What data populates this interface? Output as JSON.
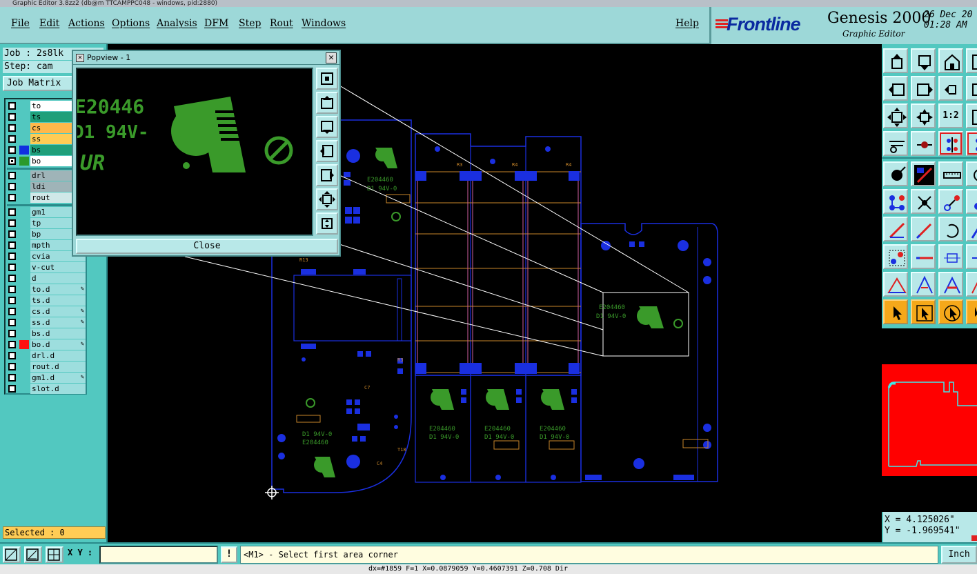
{
  "window": {
    "title_bar": "Graphic Editor 3.8zz2 (db@m TTCAMPPC048 - windows, pid:2880)"
  },
  "menu": {
    "items": [
      "File",
      "Edit",
      "Actions",
      "Options",
      "Analysis",
      "DFM",
      "Step",
      "Rout",
      "Windows"
    ],
    "help": "Help"
  },
  "brand": {
    "logo": "Frontline",
    "product": "Genesis 2000",
    "subtitle": "Graphic Editor",
    "date_line1": "26 Dec 20",
    "date_line2": "01:28 AM"
  },
  "job": {
    "job_label": "Job : 2s8lk",
    "step_label": "Step: cam",
    "matrix_button": "Job Matrix"
  },
  "layers": [
    {
      "name": "to",
      "bg": "#ffffff",
      "swatch": "",
      "lock": false
    },
    {
      "name": "ts",
      "bg": "#1f9f7a",
      "swatch": "",
      "lock": false
    },
    {
      "name": "cs",
      "bg": "#ffb84a",
      "swatch": "",
      "lock": false
    },
    {
      "name": "ss",
      "bg": "#ffcc55",
      "swatch": "",
      "lock": false
    },
    {
      "name": "bs",
      "bg": "#1f9f7a",
      "swatch": "#1030e0",
      "lock": false
    },
    {
      "name": "bo",
      "bg": "#ffffff",
      "swatch": "#2a9a2a",
      "lock": false,
      "active": true
    },
    {
      "name": "drl",
      "bg": "#9fb4b8",
      "swatch": "",
      "lock": false
    },
    {
      "name": "ldi",
      "bg": "#9fb4b8",
      "swatch": "",
      "lock": false
    },
    {
      "name": "rout",
      "bg": "#d0e8e8",
      "swatch": "",
      "lock": false
    },
    {
      "name": "gm1",
      "bg": "#9ddede",
      "swatch": "",
      "lock": false
    },
    {
      "name": "tp",
      "bg": "#9ddede",
      "swatch": "",
      "lock": false
    },
    {
      "name": "bp",
      "bg": "#9ddede",
      "swatch": "",
      "lock": false
    },
    {
      "name": "mpth",
      "bg": "#9ddede",
      "swatch": "",
      "lock": false
    },
    {
      "name": "cvia",
      "bg": "#9ddede",
      "swatch": "",
      "lock": false
    },
    {
      "name": "v-cut",
      "bg": "#9ddede",
      "swatch": "",
      "lock": false
    },
    {
      "name": "d",
      "bg": "#9ddede",
      "swatch": "",
      "lock": false
    },
    {
      "name": "to.d",
      "bg": "#9ddede",
      "swatch": "",
      "lock": true
    },
    {
      "name": "ts.d",
      "bg": "#9ddede",
      "swatch": "",
      "lock": false
    },
    {
      "name": "cs.d",
      "bg": "#9ddede",
      "swatch": "",
      "lock": true
    },
    {
      "name": "ss.d",
      "bg": "#9ddede",
      "swatch": "",
      "lock": true
    },
    {
      "name": "bs.d",
      "bg": "#9ddede",
      "swatch": "",
      "lock": false
    },
    {
      "name": "bo.d",
      "bg": "#9ddede",
      "swatch": "#ff1010",
      "lock": true
    },
    {
      "name": "drl.d",
      "bg": "#9ddede",
      "swatch": "",
      "lock": false
    },
    {
      "name": "rout.d",
      "bg": "#9ddede",
      "swatch": "",
      "lock": false
    },
    {
      "name": "gm1.d",
      "bg": "#9ddede",
      "swatch": "",
      "lock": true
    },
    {
      "name": "slot.d",
      "bg": "#9ddede",
      "swatch": "",
      "lock": false
    }
  ],
  "selected": "Selected : 0",
  "popview": {
    "title": "Popview - 1",
    "close_button": "Close",
    "text_line1": "E20446",
    "text_line2": "D1 94V-",
    "text_line3": "UR"
  },
  "canvas": {
    "board_label_1": "E204460",
    "board_label_2": "D1 94V-0"
  },
  "tools": {
    "ratio_label": "1:2"
  },
  "coords": {
    "x": "X = 4.125026\"",
    "y": "Y = -1.969541\""
  },
  "bottom": {
    "xy_label": "X Y :",
    "xy_value": "",
    "alert": "!",
    "prompt": "<M1> - Select first area corner",
    "units": "Inch"
  },
  "status_line": "dx=#1859 F=1 X=0.0879059 Y=0.4607391 Z=0.708 Dir"
}
